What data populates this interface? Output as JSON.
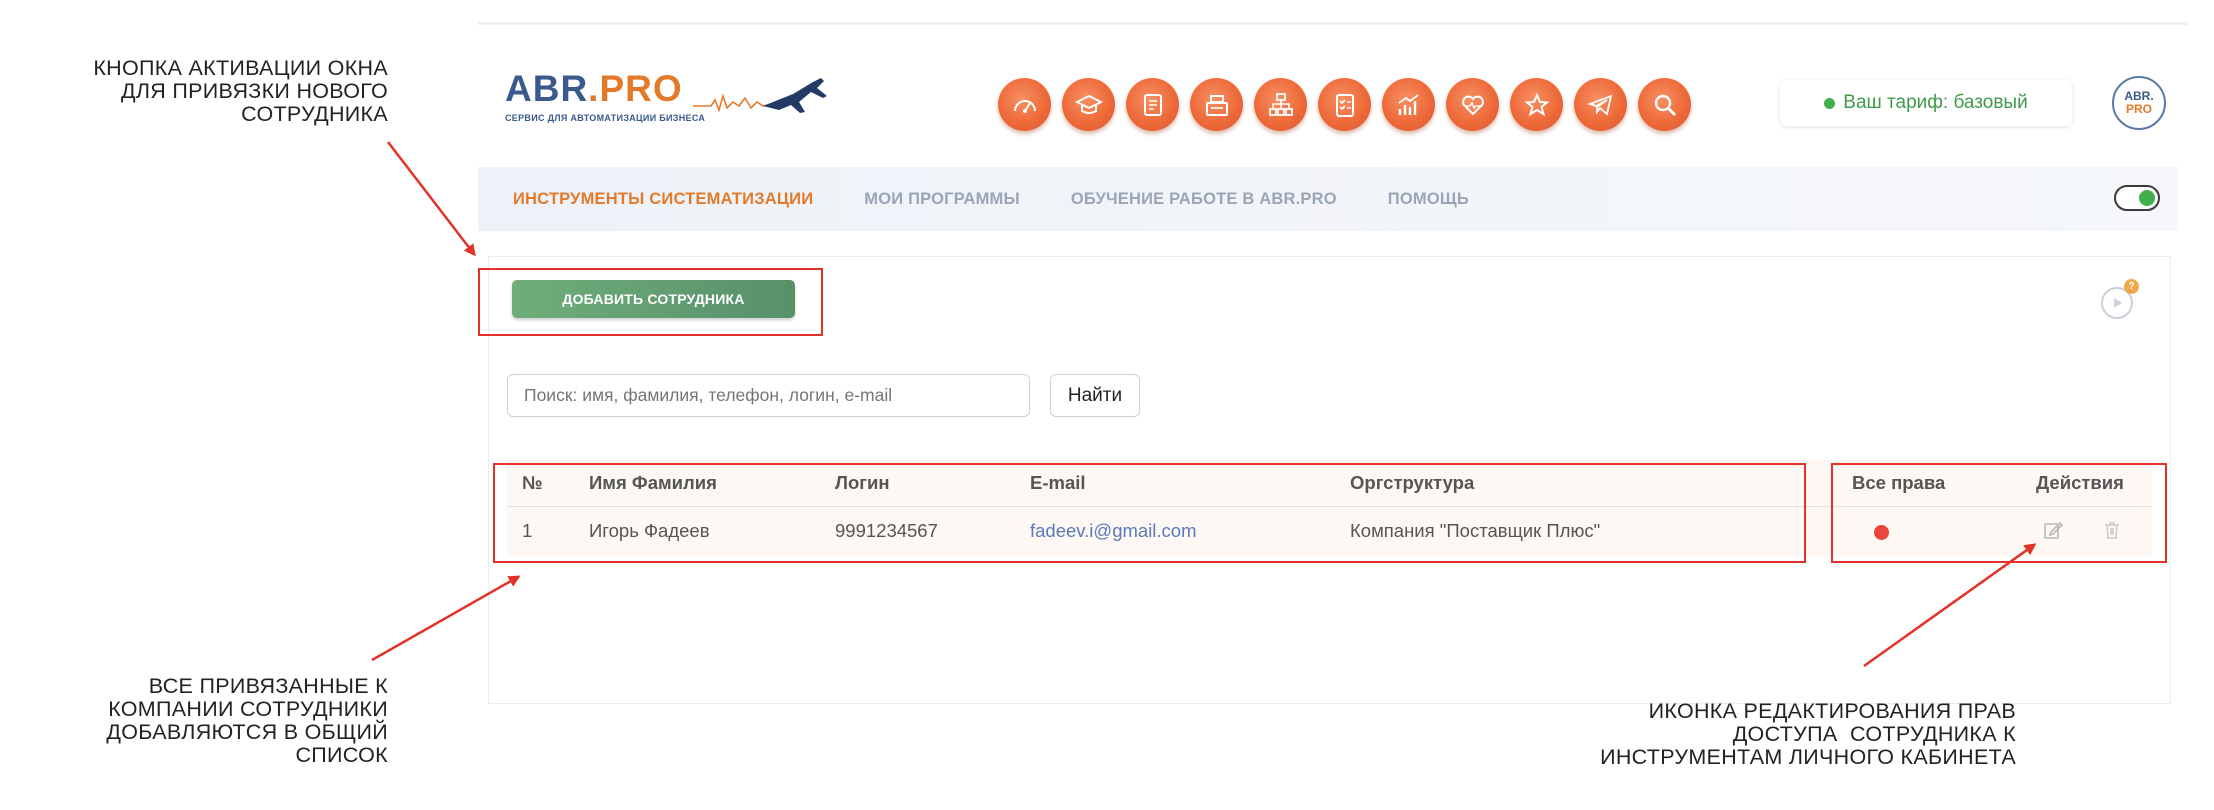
{
  "header": {
    "logo": {
      "abr": "ABR",
      "dot": ".",
      "pro": "PRO",
      "subtitle": "СЕРВИС ДЛЯ АВТОМАТИЗАЦИИ БИЗНЕСА"
    },
    "nav_icons": [
      "speedometer-icon",
      "graduation-cap-icon",
      "book-icon",
      "cash-register-icon",
      "org-chart-icon",
      "checklist-icon",
      "growth-chart-icon",
      "heart-icon",
      "star-icon",
      "telegram-icon",
      "search-icon"
    ],
    "tariff": "Ваш тариф: базовый",
    "avatar": {
      "line1": "ABR.",
      "line2": "PRO"
    }
  },
  "menu": {
    "items": [
      {
        "label": "Инструменты систематизации",
        "active": true
      },
      {
        "label": "Мои программы",
        "active": false
      },
      {
        "label": "Обучение работе в ABR.PRO",
        "active": false
      },
      {
        "label": "Помощь",
        "active": false
      }
    ]
  },
  "content": {
    "add_button": "Добавить сотрудника",
    "help_badge": "?",
    "search": {
      "placeholder": "Поиск: имя, фамилия, телефон, логин, e-mail",
      "button": "Найти"
    },
    "table": {
      "headers": [
        "№",
        "Имя Фамилия",
        "Логин",
        "E-mail",
        "Оргструктура",
        "Все права",
        "Действия"
      ],
      "rows": [
        {
          "num": "1",
          "name": "Игорь Фадеев",
          "login": "9991234567",
          "email": "fadeev.i@gmail.com",
          "org": "Компания \"Поставщик Плюс\""
        }
      ]
    }
  },
  "annotations": {
    "add_button_note": [
      "Кнопка активации окна",
      "для привязки нового",
      "сотрудника"
    ],
    "list_note": [
      "Все привязанные к",
      "компании сотрудники",
      "добавляются в общий",
      "список"
    ],
    "edit_note": [
      "Иконка редактирования прав",
      "доступа  сотрудника к",
      "инструментам личного кабинета"
    ]
  },
  "colors": {
    "accent": "#e37a2a",
    "brand": "#3a5a8c",
    "button": "#5f9a6e",
    "annotation": "#e2322a"
  }
}
